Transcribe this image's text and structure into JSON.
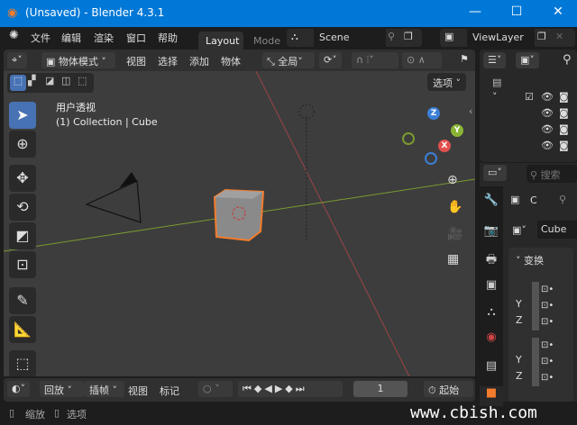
{
  "window": {
    "title": "(Unsaved) - Blender 4.3.1",
    "minimize": "—",
    "maximize": "☐",
    "close": "✕"
  },
  "menu": {
    "items": [
      "文件",
      "编辑",
      "渲染",
      "窗口",
      "帮助"
    ],
    "workspace_tabs": [
      "Layout",
      "Mode"
    ],
    "scene": "Scene",
    "view_layer": "ViewLayer"
  },
  "viewport_header": {
    "mode": "物体模式",
    "menus": [
      "视图",
      "选择",
      "添加",
      "物体"
    ],
    "transform_orientation": "全局",
    "options": "选项"
  },
  "viewport": {
    "view_name": "用户透视",
    "collection_info": "(1) Collection | Cube",
    "axes": {
      "x": "X",
      "y": "Y",
      "z": "Z"
    }
  },
  "timeline": {
    "menus": [
      "回放",
      "插帧",
      "视图",
      "标记"
    ],
    "current_frame": "1",
    "start_label": "起始"
  },
  "status": {
    "items": [
      "缩放",
      "选项"
    ]
  },
  "outliner": {
    "rows": 4
  },
  "properties": {
    "search_placeholder": "搜索",
    "object_short": "C",
    "object_name": "Cube",
    "panel_title": "变换",
    "axis_labels": [
      "Y",
      "Z",
      "Y",
      "Z"
    ]
  },
  "watermark": "www.cbish.com",
  "colors": {
    "titlebar": "#0078d7",
    "accent": "#4772b3",
    "selection": "#f47c2c",
    "x_axis": "#e0504e",
    "y_axis": "#8ab534",
    "z_axis": "#3c7fd6"
  }
}
